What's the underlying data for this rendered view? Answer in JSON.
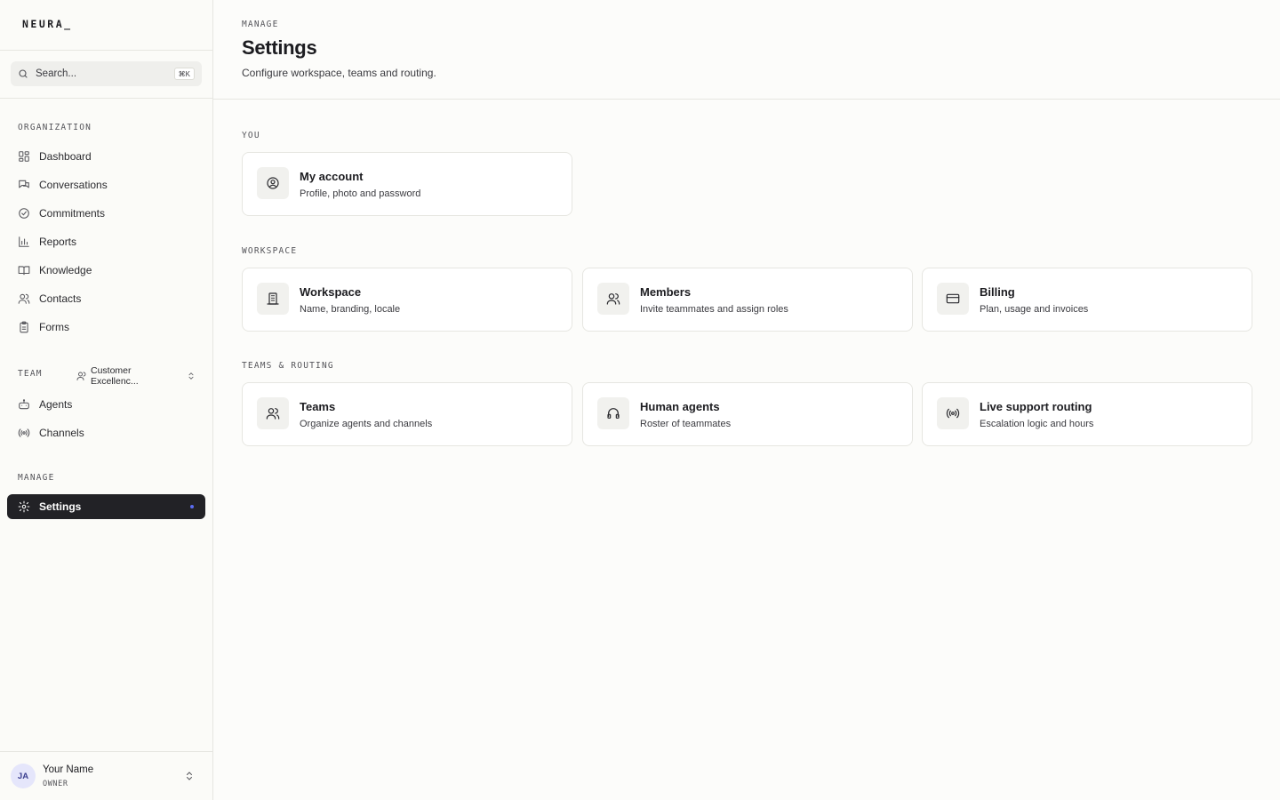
{
  "brand": {
    "logo": "NEURA_"
  },
  "search": {
    "placeholder": "Search...",
    "shortcut": "⌘K"
  },
  "sidebar": {
    "organization_label": "ORGANIZATION",
    "org_items": [
      {
        "label": "Dashboard",
        "icon": "dashboard-icon"
      },
      {
        "label": "Conversations",
        "icon": "chat-bubbles-icon"
      },
      {
        "label": "Commitments",
        "icon": "check-circle-icon"
      },
      {
        "label": "Reports",
        "icon": "bar-chart-icon"
      },
      {
        "label": "Knowledge",
        "icon": "book-icon"
      },
      {
        "label": "Contacts",
        "icon": "users-icon"
      },
      {
        "label": "Forms",
        "icon": "clipboard-icon"
      }
    ],
    "team_label": "TEAM",
    "team_selected": "Customer Excellenc...",
    "team_items": [
      {
        "label": "Agents",
        "icon": "robot-icon"
      },
      {
        "label": "Channels",
        "icon": "broadcast-icon"
      }
    ],
    "manage_label": "MANAGE",
    "manage_items": [
      {
        "label": "Settings",
        "icon": "gear-icon",
        "active": true
      }
    ]
  },
  "user": {
    "initials": "JA",
    "name": "Your Name",
    "role": "OWNER"
  },
  "header": {
    "breadcrumb": "MANAGE",
    "title": "Settings",
    "subtitle": "Configure workspace, teams and routing."
  },
  "groups": {
    "you": {
      "label": "YOU",
      "cards": [
        {
          "title": "My account",
          "subtitle": "Profile, photo and password",
          "icon": "user-circle-icon"
        }
      ]
    },
    "workspace": {
      "label": "WORKSPACE",
      "cards": [
        {
          "title": "Workspace",
          "subtitle": "Name, branding, locale",
          "icon": "building-icon"
        },
        {
          "title": "Members",
          "subtitle": "Invite teammates and assign roles",
          "icon": "users-icon"
        },
        {
          "title": "Billing",
          "subtitle": "Plan, usage and invoices",
          "icon": "credit-card-icon"
        }
      ]
    },
    "teams": {
      "label": "TEAMS & ROUTING",
      "cards": [
        {
          "title": "Teams",
          "subtitle": "Organize agents and channels",
          "icon": "users-icon"
        },
        {
          "title": "Human agents",
          "subtitle": "Roster of teammates",
          "icon": "headphones-icon"
        },
        {
          "title": "Live support routing",
          "subtitle": "Escalation logic and hours",
          "icon": "broadcast-icon"
        }
      ]
    }
  },
  "colors": {
    "active_bg": "#222226",
    "accent_dot": "#5b6cf0",
    "avatar_bg": "#e5e6fb"
  }
}
